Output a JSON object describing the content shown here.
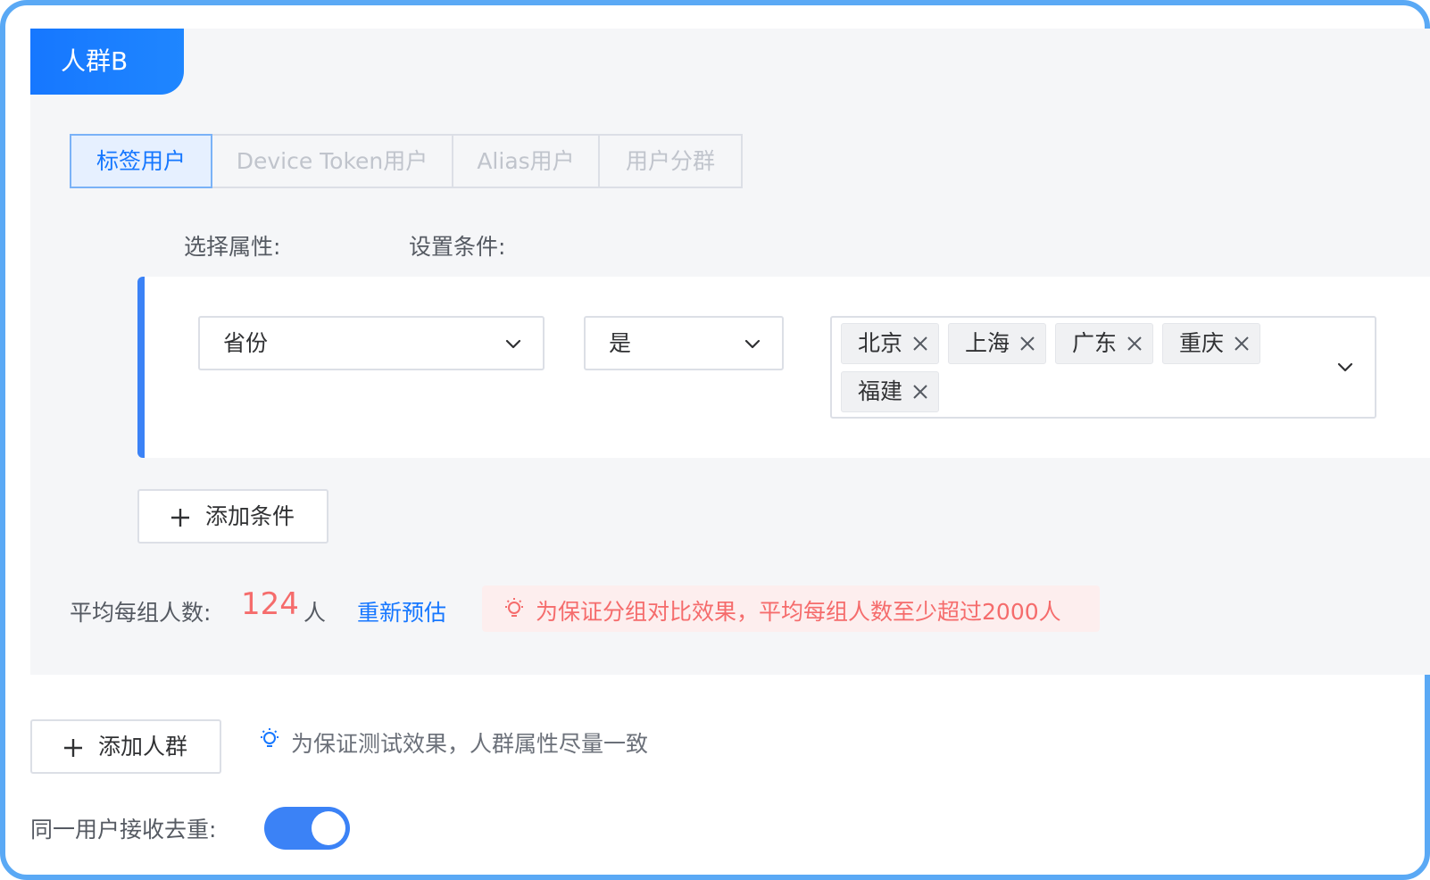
{
  "group": {
    "title": "人群B"
  },
  "tabs": [
    {
      "label": "标签用户",
      "active": true
    },
    {
      "label": "Device Token用户",
      "active": false
    },
    {
      "label": "Alias用户",
      "active": false
    },
    {
      "label": "用户分群",
      "active": false
    }
  ],
  "labels": {
    "select_attr": "选择属性:",
    "set_condition": "设置条件:"
  },
  "condition": {
    "attribute": "省份",
    "operator": "是",
    "values": [
      "北京",
      "上海",
      "广东",
      "重庆",
      "福建"
    ]
  },
  "buttons": {
    "add_condition": "添加条件",
    "add_group": "添加人群"
  },
  "estimate": {
    "label": "平均每组人数:",
    "value": "124",
    "unit": "人",
    "re_estimate": "重新预估",
    "warning": "为保证分组对比效果，平均每组人数至少超过2000人"
  },
  "hint": "为保证测试效果，人群属性尽量一致",
  "dedupe": {
    "label": "同一用户接收去重:",
    "enabled": true
  },
  "colors": {
    "accent": "#1677ff",
    "warning_text": "#f56c6c",
    "warning_bg": "#fdeeee",
    "frame_border": "#5aa9f5"
  },
  "icons": {
    "chevron": "chevron-down-icon",
    "close": "close-icon",
    "plus": "plus-icon",
    "bulb": "lightbulb-icon"
  }
}
